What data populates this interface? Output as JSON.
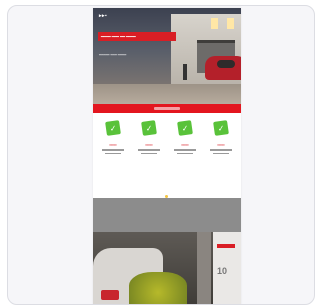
{
  "hero": {
    "logo": "",
    "headline": "",
    "subline": ""
  },
  "features": [
    {
      "icon": "check-icon",
      "title": ""
    },
    {
      "icon": "check-icon",
      "title": ""
    },
    {
      "icon": "check-icon",
      "title": ""
    },
    {
      "icon": "check-icon",
      "title": ""
    }
  ],
  "bottom": {
    "number": "10"
  },
  "colors": {
    "brand_red": "#e3161f",
    "feature_green": "#59c23a"
  }
}
